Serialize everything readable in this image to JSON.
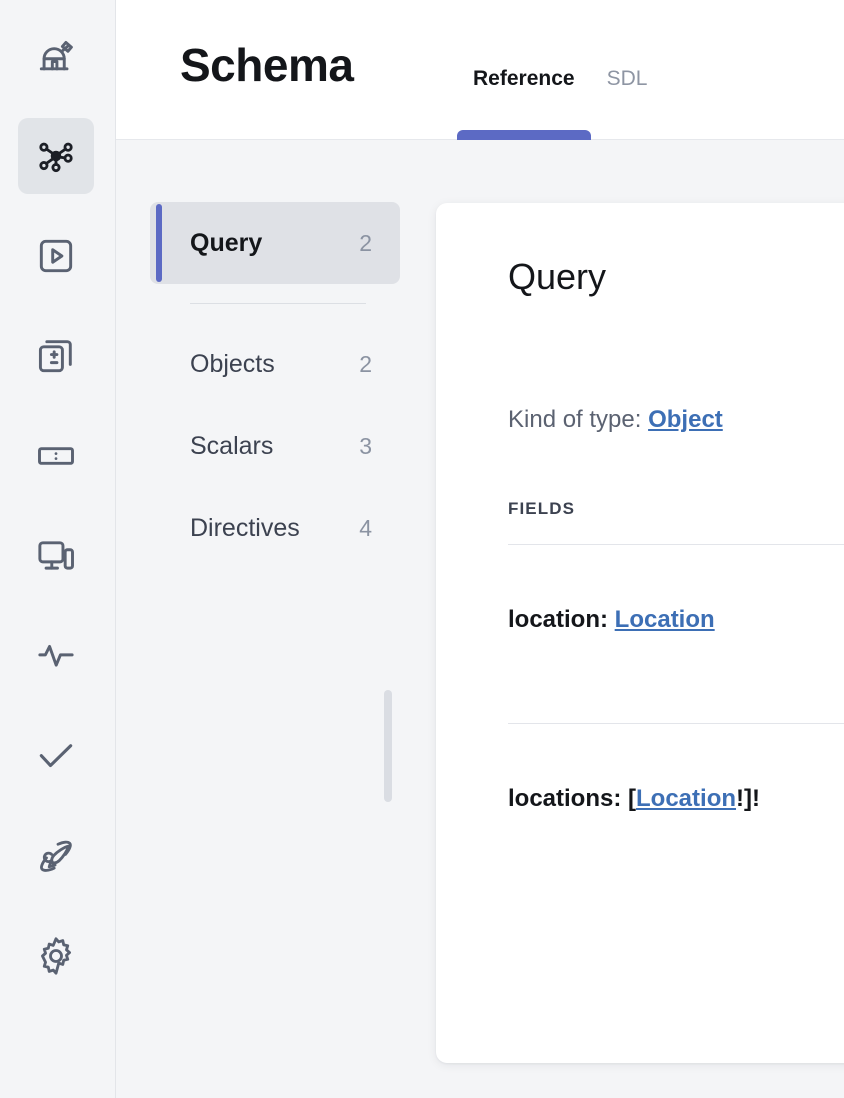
{
  "rail": {
    "items": [
      {
        "name": "observatory-icon",
        "label": "Home",
        "active": false
      },
      {
        "name": "schema-graph-icon",
        "label": "Schema",
        "active": true
      },
      {
        "name": "play-square-icon",
        "label": "Explorer",
        "active": false
      },
      {
        "name": "copy-diff-icon",
        "label": "Changelog",
        "active": false
      },
      {
        "name": "fields-box-icon",
        "label": "Fields",
        "active": false
      },
      {
        "name": "clients-icon",
        "label": "Clients",
        "active": false
      },
      {
        "name": "pulse-icon",
        "label": "Metrics",
        "active": false
      },
      {
        "name": "check-icon",
        "label": "Checks",
        "active": false
      },
      {
        "name": "rocket-icon",
        "label": "Launches",
        "active": false
      },
      {
        "name": "gear-icon",
        "label": "Settings",
        "active": false
      }
    ]
  },
  "header": {
    "title": "Schema",
    "tabs": [
      {
        "label": "Reference",
        "selected": true
      },
      {
        "label": "SDL",
        "selected": false
      }
    ],
    "accent_color": "#5c6ac4"
  },
  "type_list": {
    "items": [
      {
        "label": "Query",
        "count": "2",
        "selected": true
      },
      {
        "label": "Objects",
        "count": "2",
        "selected": false
      },
      {
        "label": "Scalars",
        "count": "3",
        "selected": false
      },
      {
        "label": "Directives",
        "count": "4",
        "selected": false
      }
    ]
  },
  "detail": {
    "title": "Query",
    "kind_label": "Kind of type: ",
    "kind_value": "Object",
    "fields_heading": "FIELDS",
    "fields": [
      {
        "name": "location: ",
        "prefix": "",
        "type": "Location",
        "suffix": ""
      },
      {
        "name": "locations: ",
        "prefix": "[",
        "type": "Location",
        "suffix": "!]!"
      }
    ],
    "link_color": "#3d6fb5"
  }
}
